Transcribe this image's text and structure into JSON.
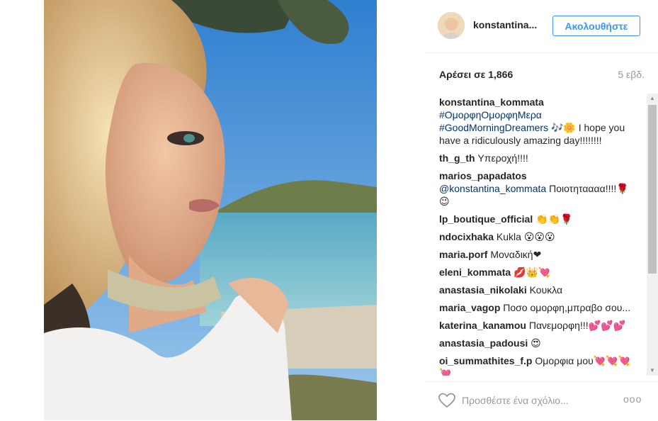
{
  "post": {
    "username": "konstantina...",
    "follow_label": "Ακολουθήστε",
    "likes": "Αρέσει σε 1,866",
    "time": "5 εβδ.",
    "comment_placeholder": "Προσθέστε ένα σχόλιο...",
    "more": "ooo"
  },
  "comments": [
    {
      "user": "konstantina_kommata",
      "tags": "#ΟμορφηΟμορφηΜερα #GoodMorningDreamers",
      "text": "🎶🌼 I hope you have a ridiculously amazing day!!!!!!!!"
    },
    {
      "user": "th_g_th",
      "tags": "",
      "text": "Υπεροχή!!!!"
    },
    {
      "user": "marios_papadatos",
      "tags": "@konstantina_kommata",
      "text": "Ποιοτηταααα!!!!🌹😉"
    },
    {
      "user": "lp_boutique_official",
      "tags": "",
      "text": "👏👏🌹"
    },
    {
      "user": "ndocixhaka",
      "tags": "",
      "text": "Kukla 😮😮😮"
    },
    {
      "user": "maria.porf",
      "tags": "",
      "text": "Μοναδική❤"
    },
    {
      "user": "eleni_kommata",
      "tags": "",
      "text": "💋👑💘"
    },
    {
      "user": "anastasia_nikolaki",
      "tags": "",
      "text": "Κουκλα"
    },
    {
      "user": "maria_vagop",
      "tags": "",
      "text": "Ποσο ομορφη,μπραβο σου..."
    },
    {
      "user": "katerina_kanamou",
      "tags": "",
      "text": "Πανεμορφη!!!💕💕💕"
    },
    {
      "user": "anastasia_padousi",
      "tags": "",
      "text": "😍"
    },
    {
      "user": "oi_summathites_f.p",
      "tags": "",
      "text": "Ομορφια μου💘💘💘💘"
    }
  ],
  "colors": {
    "accent": "#3897f0",
    "tag": "#003569",
    "muted": "#999999"
  },
  "icons": {
    "like": "heart-outline-icon",
    "more": "ellipsis-icon"
  }
}
